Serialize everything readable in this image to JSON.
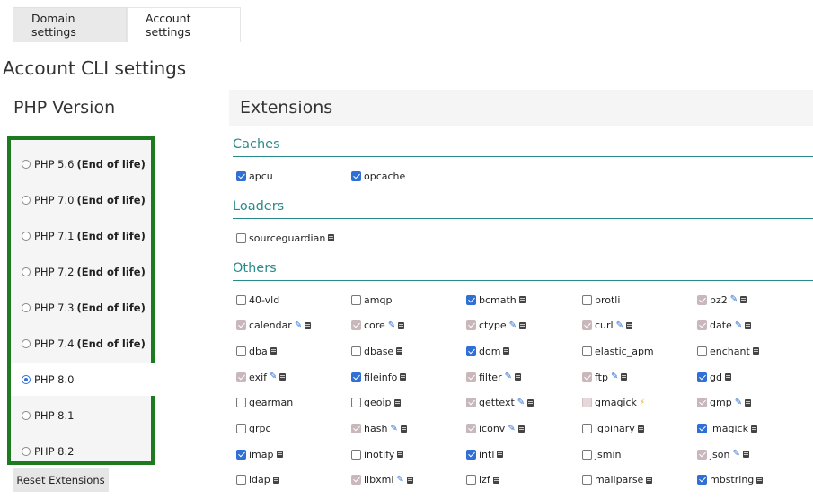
{
  "tabs": [
    {
      "label": "Domain settings",
      "active": false
    },
    {
      "label": "Account settings",
      "active": true
    }
  ],
  "page_title": "Account CLI settings",
  "php": {
    "heading": "PHP Version",
    "versions": [
      {
        "label": "PHP 5.6",
        "note": "(End of life)",
        "selected": false
      },
      {
        "label": "PHP 7.0",
        "note": "(End of life)",
        "selected": false
      },
      {
        "label": "PHP 7.1",
        "note": "(End of life)",
        "selected": false
      },
      {
        "label": "PHP 7.2",
        "note": "(End of life)",
        "selected": false
      },
      {
        "label": "PHP 7.3",
        "note": "(End of life)",
        "selected": false
      },
      {
        "label": "PHP 7.4",
        "note": "(End of life)",
        "selected": false
      },
      {
        "label": "PHP 8.0",
        "note": "",
        "selected": true
      },
      {
        "label": "PHP 8.1",
        "note": "",
        "selected": false
      },
      {
        "label": "PHP 8.2",
        "note": "",
        "selected": false
      }
    ],
    "reset_label": "Reset Extensions"
  },
  "extensions": {
    "heading": "Extensions",
    "groups": {
      "caches": {
        "title": "Caches",
        "items": [
          {
            "name": "apcu",
            "state": "checked",
            "icons": []
          },
          {
            "name": "opcache",
            "state": "checked",
            "icons": []
          }
        ]
      },
      "loaders": {
        "title": "Loaders",
        "items": [
          {
            "name": "sourceguardian",
            "state": "unchecked",
            "icons": [
              "book-icon"
            ]
          }
        ]
      },
      "others": {
        "title": "Others",
        "rows": [
          [
            {
              "name": "40-vld",
              "state": "unchecked",
              "icons": []
            },
            {
              "name": "amqp",
              "state": "unchecked",
              "icons": []
            },
            {
              "name": "bcmath",
              "state": "checked",
              "icons": [
                "book-icon"
              ]
            },
            {
              "name": "brotli",
              "state": "unchecked",
              "icons": []
            },
            {
              "name": "bz2",
              "state": "disabled",
              "icons": [
                "wrench-icon",
                "book-icon"
              ]
            }
          ],
          [
            {
              "name": "calendar",
              "state": "disabled",
              "icons": [
                "wrench-icon",
                "book-icon"
              ]
            },
            {
              "name": "core",
              "state": "disabled",
              "icons": [
                "wrench-icon",
                "book-icon"
              ]
            },
            {
              "name": "ctype",
              "state": "disabled",
              "icons": [
                "wrench-icon",
                "book-icon"
              ]
            },
            {
              "name": "curl",
              "state": "disabled",
              "icons": [
                "wrench-icon",
                "book-icon"
              ]
            },
            {
              "name": "date",
              "state": "disabled",
              "icons": [
                "wrench-icon",
                "book-icon"
              ]
            }
          ],
          [
            {
              "name": "dba",
              "state": "unchecked",
              "icons": [
                "book-icon"
              ]
            },
            {
              "name": "dbase",
              "state": "unchecked",
              "icons": [
                "book-icon"
              ]
            },
            {
              "name": "dom",
              "state": "checked",
              "icons": [
                "book-icon"
              ]
            },
            {
              "name": "elastic_apm",
              "state": "unchecked",
              "icons": []
            },
            {
              "name": "enchant",
              "state": "unchecked",
              "icons": [
                "book-icon"
              ]
            }
          ],
          [
            {
              "name": "exif",
              "state": "disabled",
              "icons": [
                "wrench-icon",
                "book-icon"
              ]
            },
            {
              "name": "fileinfo",
              "state": "checked",
              "icons": [
                "book-icon"
              ]
            },
            {
              "name": "filter",
              "state": "disabled",
              "icons": [
                "wrench-icon",
                "book-icon"
              ]
            },
            {
              "name": "ftp",
              "state": "disabled",
              "icons": [
                "wrench-icon",
                "book-icon"
              ]
            },
            {
              "name": "gd",
              "state": "checked",
              "icons": [
                "book-icon"
              ]
            }
          ],
          [
            {
              "name": "gearman",
              "state": "unchecked",
              "icons": []
            },
            {
              "name": "geoip",
              "state": "unchecked",
              "icons": [
                "book-icon"
              ]
            },
            {
              "name": "gettext",
              "state": "disabled",
              "icons": [
                "wrench-icon",
                "book-icon"
              ]
            },
            {
              "name": "gmagick",
              "state": "disabled-empty",
              "icons": [
                "bolt-icon"
              ]
            },
            {
              "name": "gmp",
              "state": "disabled",
              "icons": [
                "wrench-icon",
                "book-icon"
              ]
            }
          ],
          [
            {
              "name": "grpc",
              "state": "unchecked",
              "icons": []
            },
            {
              "name": "hash",
              "state": "disabled",
              "icons": [
                "wrench-icon",
                "book-icon"
              ]
            },
            {
              "name": "iconv",
              "state": "disabled",
              "icons": [
                "wrench-icon",
                "book-icon"
              ]
            },
            {
              "name": "igbinary",
              "state": "unchecked",
              "icons": [
                "book-icon"
              ]
            },
            {
              "name": "imagick",
              "state": "checked",
              "icons": [
                "book-icon"
              ]
            }
          ],
          [
            {
              "name": "imap",
              "state": "checked",
              "icons": [
                "book-icon"
              ]
            },
            {
              "name": "inotify",
              "state": "unchecked",
              "icons": [
                "book-icon"
              ]
            },
            {
              "name": "intl",
              "state": "checked",
              "icons": [
                "book-icon"
              ]
            },
            {
              "name": "jsmin",
              "state": "unchecked",
              "icons": []
            },
            {
              "name": "json",
              "state": "disabled",
              "icons": [
                "wrench-icon",
                "book-icon"
              ]
            }
          ],
          [
            {
              "name": "ldap",
              "state": "unchecked",
              "icons": [
                "book-icon"
              ]
            },
            {
              "name": "libxml",
              "state": "disabled",
              "icons": [
                "wrench-icon",
                "book-icon"
              ]
            },
            {
              "name": "lzf",
              "state": "unchecked",
              "icons": [
                "book-icon"
              ]
            },
            {
              "name": "mailparse",
              "state": "unchecked",
              "icons": [
                "book-icon"
              ]
            },
            {
              "name": "mbstring",
              "state": "checked",
              "icons": [
                "book-icon"
              ]
            }
          ]
        ]
      }
    }
  }
}
